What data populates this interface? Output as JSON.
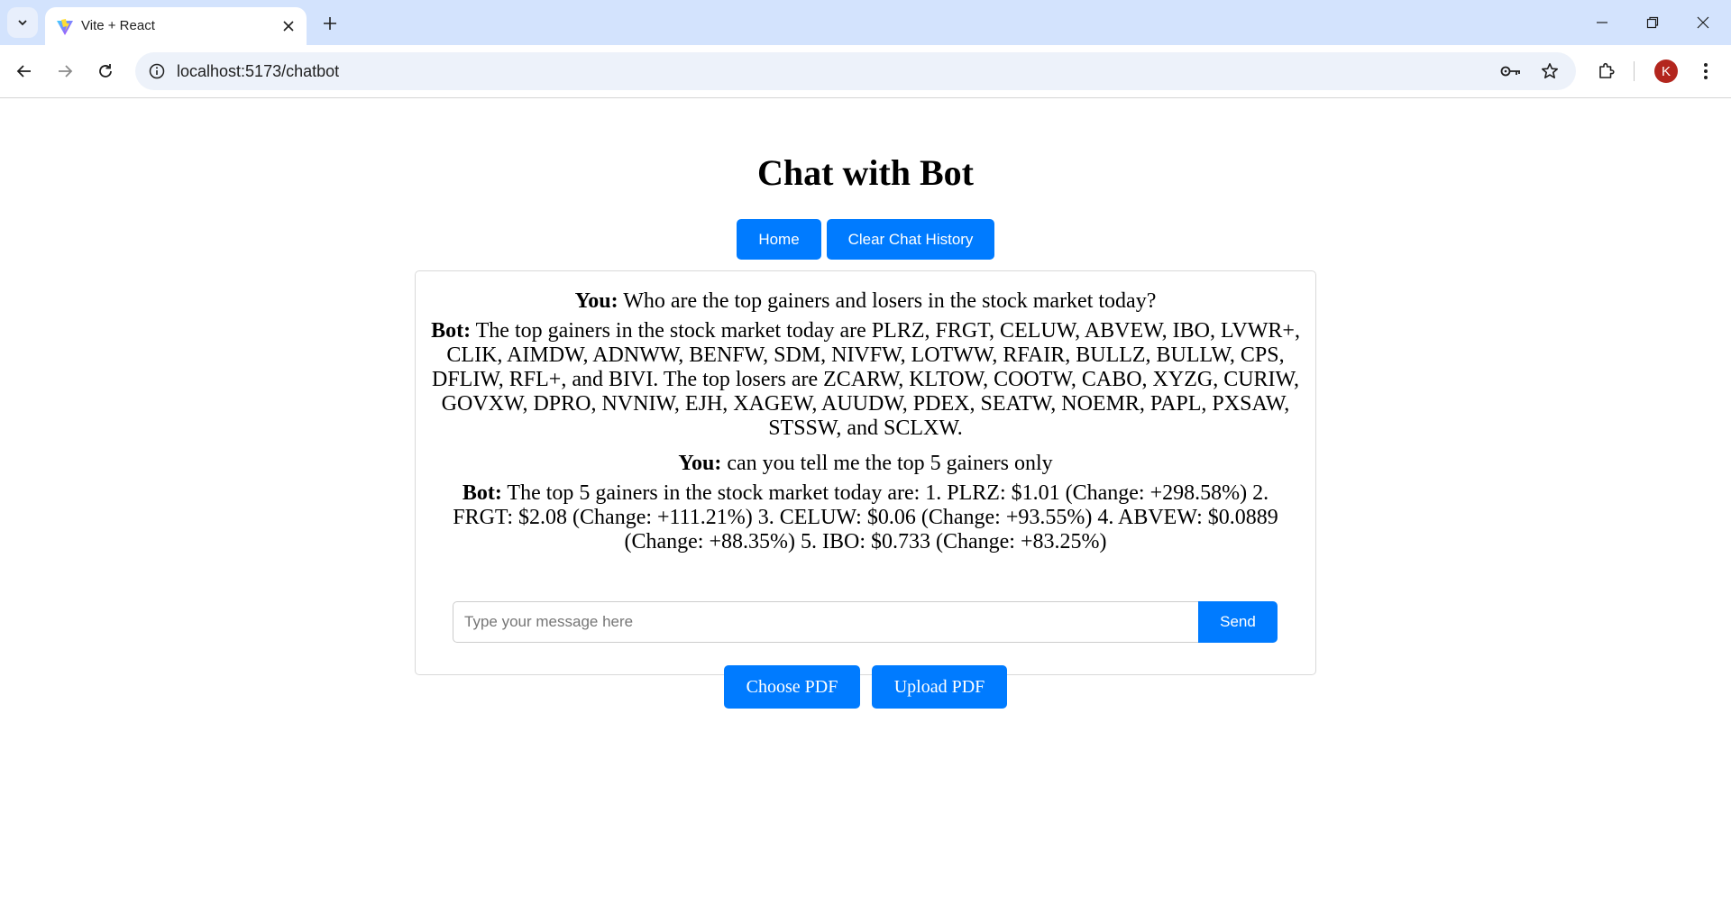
{
  "browser": {
    "tab_title": "Vite + React",
    "url": "localhost:5173/chatbot",
    "profile_initial": "K"
  },
  "page": {
    "title": "Chat with Bot",
    "home_label": "Home",
    "clear_label": "Clear Chat History"
  },
  "messages": [
    {
      "who": "You:",
      "text": " Who are the top gainers and losers in the stock market today?"
    },
    {
      "who": "Bot:",
      "text": " The top gainers in the stock market today are PLRZ, FRGT, CELUW, ABVEW, IBO, LVWR+, CLIK, AIMDW, ADNWW, BENFW, SDM, NIVFW, LOTWW, RFAIR, BULLZ, BULLW, CPS, DFLIW, RFL+, and BIVI. The top losers are ZCARW, KLTOW, COOTW, CABO, XYZG, CURIW, GOVXW, DPRO, NVNIW, EJH, XAGEW, AUUDW, PDEX, SEATW, NOEMR, PAPL, PXSAW, STSSW, and SCLXW."
    },
    {
      "who": "You:",
      "text": " can you tell me the top 5 gainers only"
    },
    {
      "who": "Bot:",
      "text": " The top 5 gainers in the stock market today are: 1. PLRZ: $1.01 (Change: +298.58%) 2. FRGT: $2.08 (Change: +111.21%) 3. CELUW: $0.06 (Change: +93.55%) 4. ABVEW: $0.0889 (Change: +88.35%) 5. IBO: $0.733 (Change: +83.25%)"
    }
  ],
  "composer": {
    "placeholder": "Type your message here",
    "value": "",
    "send_label": "Send"
  },
  "pdf": {
    "choose_label": "Choose PDF",
    "upload_label": "Upload PDF"
  },
  "colors": {
    "accent": "#007bff",
    "chrome_bg": "#d3e3fd",
    "avatar": "#b3261e"
  }
}
